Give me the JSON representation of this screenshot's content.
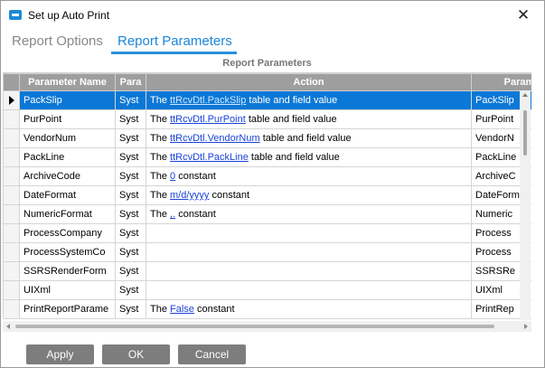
{
  "window": {
    "title": "Set up Auto Print",
    "close_glyph": "✕"
  },
  "tabs": [
    {
      "label": "Report Options"
    },
    {
      "label": "Report Parameters"
    }
  ],
  "grid": {
    "caption": "Report Parameters",
    "columns": [
      "Parameter Name",
      "Para",
      "Action",
      "Parame"
    ],
    "rows": [
      {
        "name": "PackSlip",
        "type": "Syst",
        "prefix": "The ",
        "link": "ttRcvDtl.PackSlip",
        "suffix": " table and field value",
        "param": "PackSlip"
      },
      {
        "name": "PurPoint",
        "type": "Syst",
        "prefix": "The ",
        "link": "ttRcvDtl.PurPoint",
        "suffix": " table and field value",
        "param": "PurPoint"
      },
      {
        "name": "VendorNum",
        "type": "Syst",
        "prefix": "The ",
        "link": "ttRcvDtl.VendorNum",
        "suffix": " table and field value",
        "param": "VendorN"
      },
      {
        "name": "PackLine",
        "type": "Syst",
        "prefix": "The ",
        "link": "ttRcvDtl.PackLine",
        "suffix": " table and field value",
        "param": "PackLine"
      },
      {
        "name": "ArchiveCode",
        "type": "Syst",
        "prefix": "The ",
        "link": "0",
        "suffix": " constant",
        "param": "ArchiveC"
      },
      {
        "name": "DateFormat",
        "type": "Syst",
        "prefix": "The ",
        "link": "m/d/yyyy",
        "suffix": " constant",
        "param": "DateForm"
      },
      {
        "name": "NumericFormat",
        "type": "Syst",
        "prefix": "The ",
        "link": ",.",
        "suffix": " constant",
        "param": "Numeric"
      },
      {
        "name": "ProcessCompany",
        "type": "Syst",
        "prefix": "",
        "link": "",
        "suffix": "",
        "param": "Process"
      },
      {
        "name": "ProcessSystemCo",
        "type": "Syst",
        "prefix": "",
        "link": "",
        "suffix": "",
        "param": "Process"
      },
      {
        "name": "SSRSRenderForm",
        "type": "Syst",
        "prefix": "",
        "link": "",
        "suffix": "",
        "param": "SSRSRe"
      },
      {
        "name": "UIXml",
        "type": "Syst",
        "prefix": "",
        "link": "",
        "suffix": "",
        "param": "UIXml"
      },
      {
        "name": "PrintReportParame",
        "type": "Syst",
        "prefix": "The ",
        "link": "False",
        "suffix": " constant",
        "param": "PrintRep"
      }
    ]
  },
  "buttons": {
    "apply": "Apply",
    "ok": "OK",
    "cancel": "Cancel"
  },
  "colors": {
    "accent": "#1b86d9",
    "selection": "#0b78d7",
    "header": "#9e9e9e",
    "button": "#7d7d7d"
  }
}
